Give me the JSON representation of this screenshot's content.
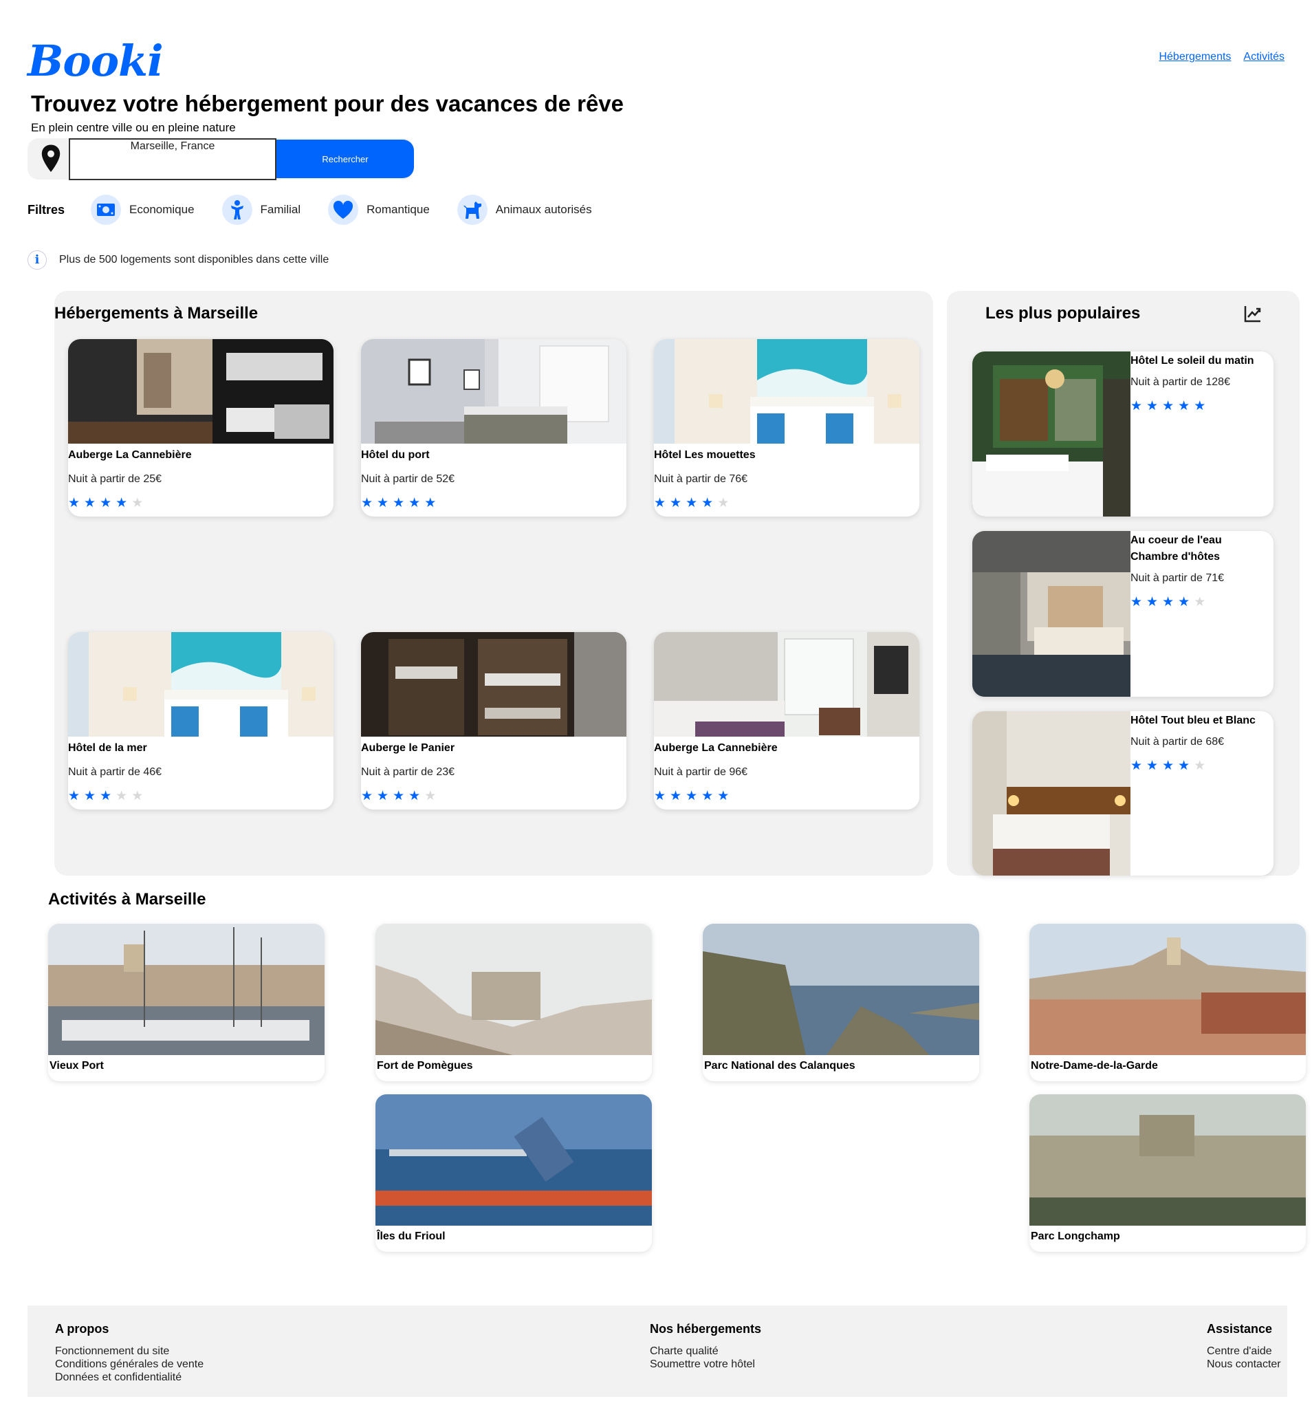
{
  "brand": {
    "name": "Booki",
    "accent": "#0065FC"
  },
  "nav": {
    "items": [
      "Hébergements",
      "Activités"
    ]
  },
  "hero": {
    "title": "Trouvez votre hébergement pour des vacances de rêve",
    "subtitle": "En plein centre ville ou en pleine nature"
  },
  "search": {
    "value": "Marseille, France",
    "button_label": "Rechercher",
    "icon": "map-pin-icon"
  },
  "filters": {
    "label": "Filtres",
    "items": [
      {
        "label": "Economique",
        "icon": "money-icon"
      },
      {
        "label": "Familial",
        "icon": "child-icon"
      },
      {
        "label": "Romantique",
        "icon": "heart-icon"
      },
      {
        "label": "Animaux autorisés",
        "icon": "dog-icon"
      }
    ]
  },
  "info": {
    "icon": "info-icon",
    "text": "Plus de 500 logements sont disponibles dans cette ville"
  },
  "hebergements": {
    "title": "Hébergements à Marseille",
    "cards": [
      {
        "name": "Auberge La Cannebière",
        "price": "Nuit à partir de 25€",
        "rating": 4
      },
      {
        "name": "Hôtel du port",
        "price": "Nuit à partir de 52€",
        "rating": 5
      },
      {
        "name": "Hôtel Les mouettes",
        "price": "Nuit à partir de 76€",
        "rating": 4
      },
      {
        "name": "Hôtel de la mer",
        "price": "Nuit à partir de 46€",
        "rating": 3
      },
      {
        "name": "Auberge le Panier",
        "price": "Nuit à partir de 23€",
        "rating": 4
      },
      {
        "name": "Auberge La Cannebière",
        "price": "Nuit à partir de 96€",
        "rating": 5
      }
    ]
  },
  "populaires": {
    "title": "Les plus populaires",
    "icon": "trending-icon",
    "cards": [
      {
        "name": "Hôtel Le soleil du matin",
        "price": "Nuit à partir de 128€",
        "rating": 5
      },
      {
        "name": "Au coeur de l'eau Chambre d'hôtes",
        "price": "Nuit à partir de 71€",
        "rating": 4
      },
      {
        "name": "Hôtel Tout bleu et Blanc",
        "price": "Nuit à partir de 68€",
        "rating": 4
      }
    ]
  },
  "activites": {
    "title": "Activités à Marseille",
    "cards": [
      {
        "name": "Vieux Port"
      },
      {
        "name": "Fort de Pomègues"
      },
      {
        "name": "Parc National des Calanques"
      },
      {
        "name": "Notre-Dame-de-la-Garde"
      },
      {
        "name": "Îles du Frioul"
      },
      {
        "name": "Parc Longchamp"
      }
    ]
  },
  "footer": {
    "columns": [
      {
        "title": "A propos",
        "links": [
          "Fonctionnement du site",
          "Conditions générales de vente",
          "Données et confidentialité"
        ]
      },
      {
        "title": "Nos hébergements",
        "links": [
          "Charte qualité",
          "Soumettre votre hôtel"
        ]
      },
      {
        "title": "Assistance",
        "links": [
          "Centre d'aide",
          "Nous contacter"
        ]
      }
    ]
  }
}
